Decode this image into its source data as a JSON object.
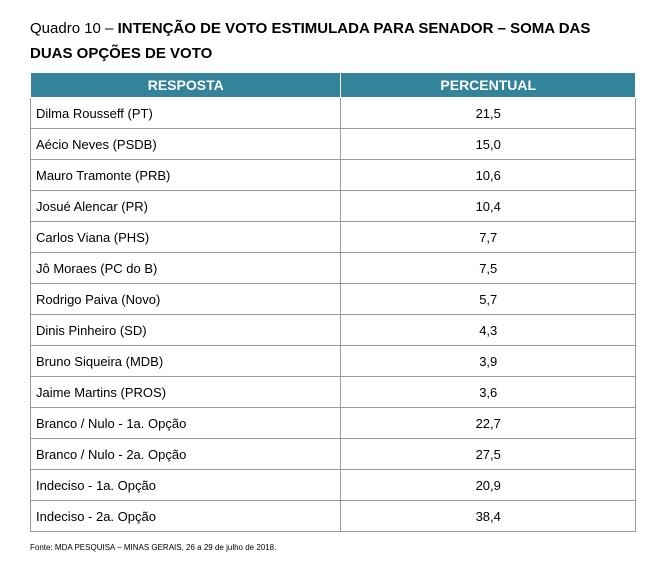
{
  "title": {
    "prefix": "Quadro 10 – ",
    "bold": "INTENÇÃO DE VOTO ESTIMULADA PARA SENADOR – SOMA DAS DUAS OPÇÕES DE VOTO"
  },
  "table": {
    "headers": [
      "RESPOSTA",
      "PERCENTUAL"
    ],
    "rows": [
      {
        "resposta": "Dilma Rousseff (PT)",
        "percentual": "21,5"
      },
      {
        "resposta": "Aécio Neves (PSDB)",
        "percentual": "15,0"
      },
      {
        "resposta": "Mauro Tramonte (PRB)",
        "percentual": "10,6"
      },
      {
        "resposta": "Josué Alencar (PR)",
        "percentual": "10,4"
      },
      {
        "resposta": "Carlos Viana (PHS)",
        "percentual": "7,7"
      },
      {
        "resposta": "Jô Moraes (PC do B)",
        "percentual": "7,5"
      },
      {
        "resposta": "Rodrigo Paiva (Novo)",
        "percentual": "5,7"
      },
      {
        "resposta": "Dinis Pinheiro (SD)",
        "percentual": "4,3"
      },
      {
        "resposta": "Bruno Siqueira (MDB)",
        "percentual": "3,9"
      },
      {
        "resposta": "Jaime Martins (PROS)",
        "percentual": "3,6"
      },
      {
        "resposta": "Branco / Nulo - 1a. Opção",
        "percentual": "22,7"
      },
      {
        "resposta": "Branco / Nulo - 2a. Opção",
        "percentual": "27,5"
      },
      {
        "resposta": "Indeciso - 1a. Opção",
        "percentual": "20,9"
      },
      {
        "resposta": "Indeciso - 2a. Opção",
        "percentual": "38,4"
      }
    ]
  },
  "footnote": "Fonte: MDA PESQUISA – MINAS GERAIS, 26 a 29 de julho de 2018.",
  "colors": {
    "header_bg": "#33849b",
    "header_text": "#ffffff",
    "border": "#9a9a9a"
  }
}
